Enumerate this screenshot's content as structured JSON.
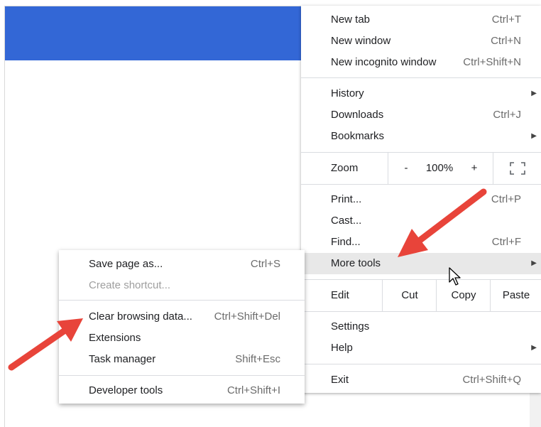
{
  "menu": {
    "new_tab": {
      "label": "New tab",
      "shortcut": "Ctrl+T"
    },
    "new_window": {
      "label": "New window",
      "shortcut": "Ctrl+N"
    },
    "new_incognito": {
      "label": "New incognito window",
      "shortcut": "Ctrl+Shift+N"
    },
    "history": {
      "label": "History"
    },
    "downloads": {
      "label": "Downloads",
      "shortcut": "Ctrl+J"
    },
    "bookmarks": {
      "label": "Bookmarks"
    },
    "zoom": {
      "label": "Zoom",
      "minus": "-",
      "level": "100%",
      "plus": "+"
    },
    "print": {
      "label": "Print...",
      "shortcut": "Ctrl+P"
    },
    "cast": {
      "label": "Cast..."
    },
    "find": {
      "label": "Find...",
      "shortcut": "Ctrl+F"
    },
    "more_tools": {
      "label": "More tools"
    },
    "edit": {
      "label": "Edit",
      "cut": "Cut",
      "copy": "Copy",
      "paste": "Paste"
    },
    "settings": {
      "label": "Settings"
    },
    "help": {
      "label": "Help"
    },
    "exit": {
      "label": "Exit",
      "shortcut": "Ctrl+Shift+Q"
    }
  },
  "submenu": {
    "save_page": {
      "label": "Save page as...",
      "shortcut": "Ctrl+S"
    },
    "create_shortcut": {
      "label": "Create shortcut..."
    },
    "clear_data": {
      "label": "Clear browsing data...",
      "shortcut": "Ctrl+Shift+Del"
    },
    "extensions": {
      "label": "Extensions"
    },
    "task_manager": {
      "label": "Task manager",
      "shortcut": "Shift+Esc"
    },
    "developer_tools": {
      "label": "Developer tools",
      "shortcut": "Ctrl+Shift+I"
    }
  },
  "colors": {
    "header_blue": "#3367d6",
    "annotation_red": "#e8443a",
    "hover_gray": "#e8e8e8"
  },
  "icons": {
    "submenu_arrow": "triangle-right-icon",
    "fullscreen": "fullscreen-icon",
    "cursor": "mouse-pointer-icon",
    "annotation": "red-arrow-icon"
  }
}
